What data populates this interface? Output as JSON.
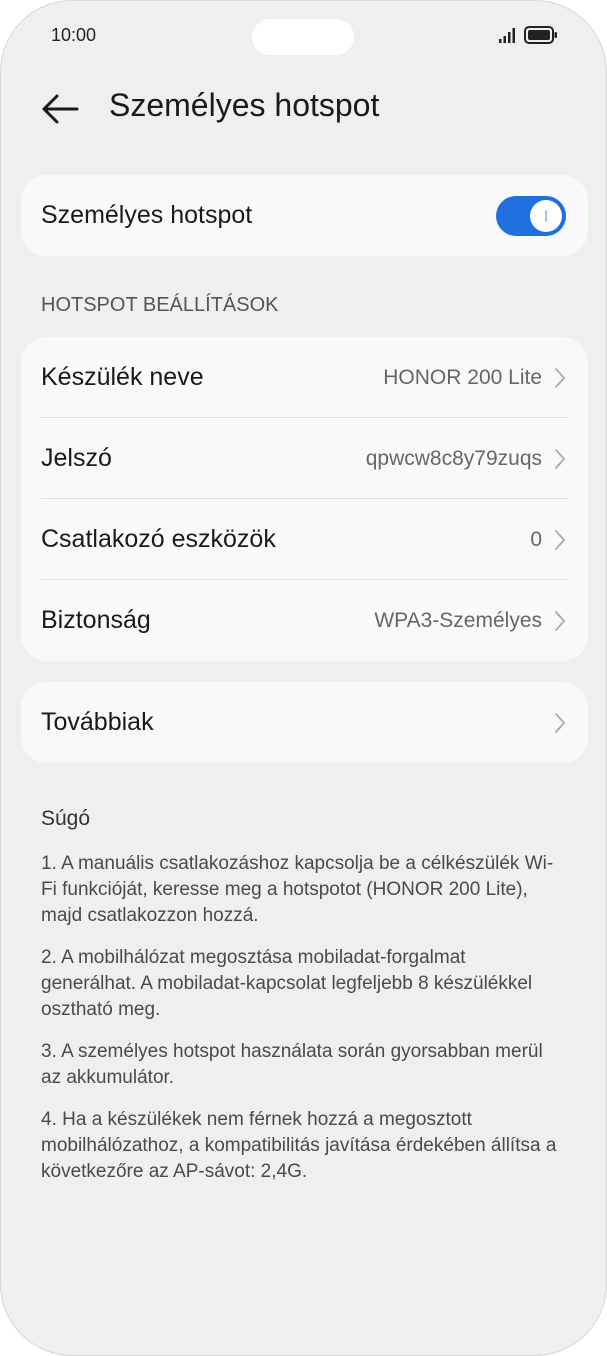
{
  "status_bar": {
    "time": "10:00"
  },
  "app_bar": {
    "title": "Személyes hotspot"
  },
  "main_toggle": {
    "label": "Személyes hotspot",
    "enabled": true,
    "color": "#1f6fe0"
  },
  "settings": {
    "header": "HOTSPOT BEÁLLÍTÁSOK",
    "rows": [
      {
        "label": "Készülék neve",
        "value": "HONOR 200 Lite"
      },
      {
        "label": "Jelszó",
        "value": "qpwcw8c8y79zuqs"
      },
      {
        "label": "Csatlakozó eszközök",
        "value": "0"
      },
      {
        "label": "Biztonság",
        "value": "WPA3-Személyes"
      }
    ]
  },
  "more": {
    "label": "Továbbiak"
  },
  "help": {
    "title": "Súgó",
    "items": [
      "1. A manuális csatlakozáshoz kapcsolja be a célkészülék Wi-Fi funkcióját, keresse meg a hotspotot (HONOR 200 Lite), majd csatlakozzon hozzá.",
      "2. A mobilhálózat megosztása mobiladat-forgalmat generálhat. A mobiladat-kapcsolat legfeljebb 8 készülékkel osztható meg.",
      "3. A személyes hotspot használata során gyorsabban merül az akkumulátor.",
      "4. Ha a készülékek nem férnek hozzá a megosztott mobilhálózathoz, a kompatibilitás javítása érdekében állítsa a következőre az AP-sávot: 2,4G."
    ]
  }
}
